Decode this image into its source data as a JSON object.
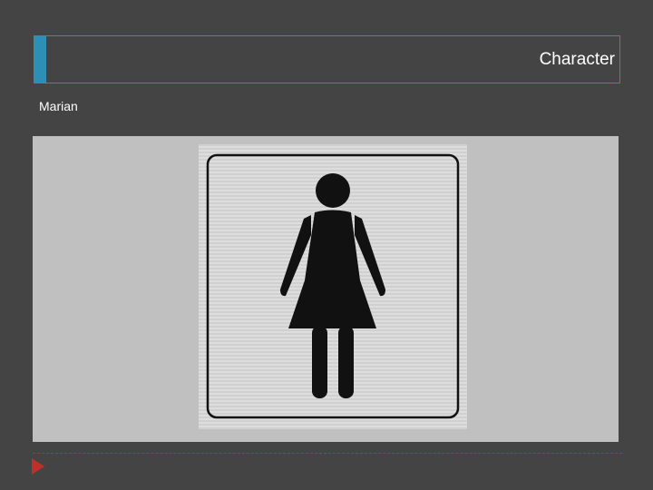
{
  "slide": {
    "title": "Character",
    "subtitle": "Marian"
  },
  "image": {
    "subject": "female-restroom-sign-icon"
  },
  "colors": {
    "background": "#444444",
    "accent": "#2e8fb4",
    "footer_line": "#b8322c",
    "arrow": "#c0302a"
  }
}
